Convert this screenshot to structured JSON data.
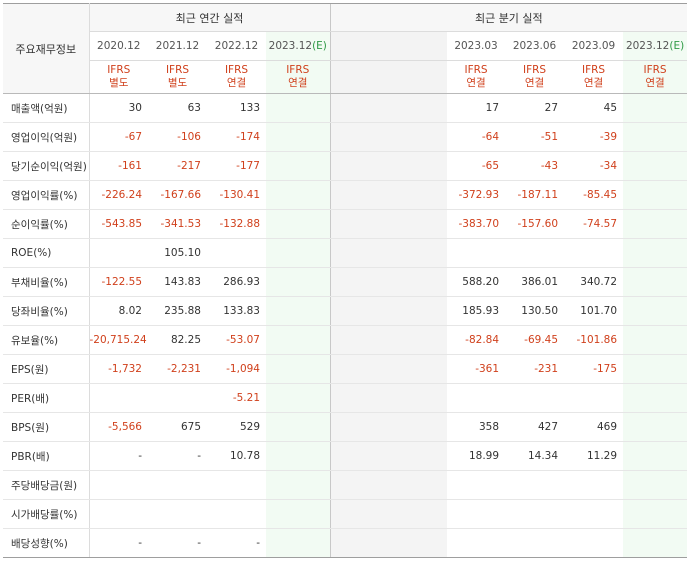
{
  "table": {
    "corner_label": "주요재무정보",
    "group_annual": "최근 연간 실적",
    "group_quarter": "최근 분기 실적",
    "annual_periods": [
      "2020.12",
      "2021.12",
      "2022.12",
      "2023.12",
      "(E)"
    ],
    "quarter_periods": [
      "2023.03",
      "2023.06",
      "2023.09",
      "2023.12",
      "(E)"
    ],
    "annual_basis": [
      {
        "std": "IFRS",
        "type": "별도"
      },
      {
        "std": "IFRS",
        "type": "별도"
      },
      {
        "std": "IFRS",
        "type": "연결"
      },
      {
        "std": "IFRS",
        "type": "연결"
      }
    ],
    "quarter_basis": [
      {
        "std": "IFRS",
        "type": "연결"
      },
      {
        "std": "IFRS",
        "type": "연결"
      },
      {
        "std": "IFRS",
        "type": "연결"
      },
      {
        "std": "IFRS",
        "type": "연결"
      }
    ],
    "rows": [
      {
        "label": "매출액(억원)",
        "a": [
          "30",
          "63",
          "133",
          ""
        ],
        "q": [
          "17",
          "27",
          "45",
          ""
        ]
      },
      {
        "label": "영업이익(억원)",
        "a": [
          "-67",
          "-106",
          "-174",
          ""
        ],
        "q": [
          "-64",
          "-51",
          "-39",
          ""
        ]
      },
      {
        "label": "당기순이익(억원)",
        "a": [
          "-161",
          "-217",
          "-177",
          ""
        ],
        "q": [
          "-65",
          "-43",
          "-34",
          ""
        ]
      },
      {
        "label": "영업이익률(%)",
        "a": [
          "-226.24",
          "-167.66",
          "-130.41",
          ""
        ],
        "q": [
          "-372.93",
          "-187.11",
          "-85.45",
          ""
        ]
      },
      {
        "label": "순이익률(%)",
        "a": [
          "-543.85",
          "-341.53",
          "-132.88",
          ""
        ],
        "q": [
          "-383.70",
          "-157.60",
          "-74.57",
          ""
        ]
      },
      {
        "label": "ROE(%)",
        "a": [
          "",
          "105.10",
          "",
          ""
        ],
        "q": [
          "",
          "",
          "",
          ""
        ]
      },
      {
        "label": "부채비율(%)",
        "a": [
          "-122.55",
          "143.83",
          "286.93",
          ""
        ],
        "q": [
          "588.20",
          "386.01",
          "340.72",
          ""
        ]
      },
      {
        "label": "당좌비율(%)",
        "a": [
          "8.02",
          "235.88",
          "133.83",
          ""
        ],
        "q": [
          "185.93",
          "130.50",
          "101.70",
          ""
        ]
      },
      {
        "label": "유보율(%)",
        "a": [
          "-20,715.24",
          "82.25",
          "-53.07",
          ""
        ],
        "q": [
          "-82.84",
          "-69.45",
          "-101.86",
          ""
        ]
      },
      {
        "label": "EPS(원)",
        "a": [
          "-1,732",
          "-2,231",
          "-1,094",
          ""
        ],
        "q": [
          "-361",
          "-231",
          "-175",
          ""
        ]
      },
      {
        "label": "PER(배)",
        "a": [
          "",
          "",
          "-5.21",
          ""
        ],
        "q": [
          "",
          "",
          "",
          ""
        ]
      },
      {
        "label": "BPS(원)",
        "a": [
          "-5,566",
          "675",
          "529",
          ""
        ],
        "q": [
          "358",
          "427",
          "469",
          ""
        ]
      },
      {
        "label": "PBR(배)",
        "a": [
          "-",
          "-",
          "10.78",
          ""
        ],
        "q": [
          "18.99",
          "14.34",
          "11.29",
          ""
        ]
      },
      {
        "label": "주당배당금(원)",
        "a": [
          "",
          "",
          "",
          ""
        ],
        "q": [
          "",
          "",
          "",
          ""
        ]
      },
      {
        "label": "시가배당률(%)",
        "a": [
          "",
          "",
          "",
          ""
        ],
        "q": [
          "",
          "",
          "",
          ""
        ]
      },
      {
        "label": "배당성향(%)",
        "a": [
          "-",
          "-",
          "-",
          ""
        ],
        "q": [
          "",
          "",
          "",
          ""
        ]
      }
    ]
  },
  "colors": {
    "negative": "#d0401c",
    "estimate": "#2f9a46",
    "header_bg": "#f7f7f7"
  }
}
